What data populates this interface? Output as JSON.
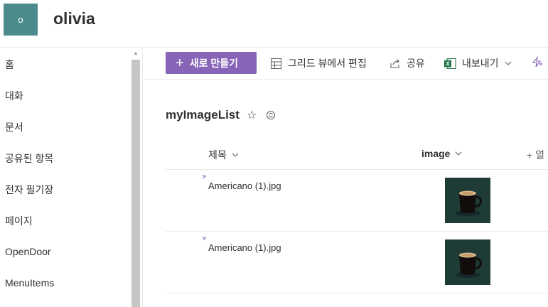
{
  "site": {
    "logo_letter": "o",
    "title": "olivia"
  },
  "sidebar": {
    "items": [
      {
        "label": "홈"
      },
      {
        "label": "대화"
      },
      {
        "label": "문서"
      },
      {
        "label": "공유된 항목"
      },
      {
        "label": "전자 필기장"
      },
      {
        "label": "페이지"
      },
      {
        "label": "OpenDoor"
      },
      {
        "label": "MenuItems"
      }
    ]
  },
  "commandbar": {
    "new_label": "새로 만들기",
    "grid_edit_label": "그리드 뷰에서 편집",
    "share_label": "공유",
    "export_label": "내보내기"
  },
  "list": {
    "title": "myImageList",
    "columns": {
      "title": "제목",
      "image": "image",
      "add_column": "+ 열"
    },
    "rows": [
      {
        "title": "Americano (1).jpg",
        "image": "coffee-mug-thumbnail"
      },
      {
        "title": "Americano (1).jpg",
        "image": "coffee-mug-thumbnail"
      }
    ]
  },
  "colors": {
    "accent": "#8764b8",
    "logo_bg": "#4c8b8b",
    "excel_green": "#217346"
  }
}
